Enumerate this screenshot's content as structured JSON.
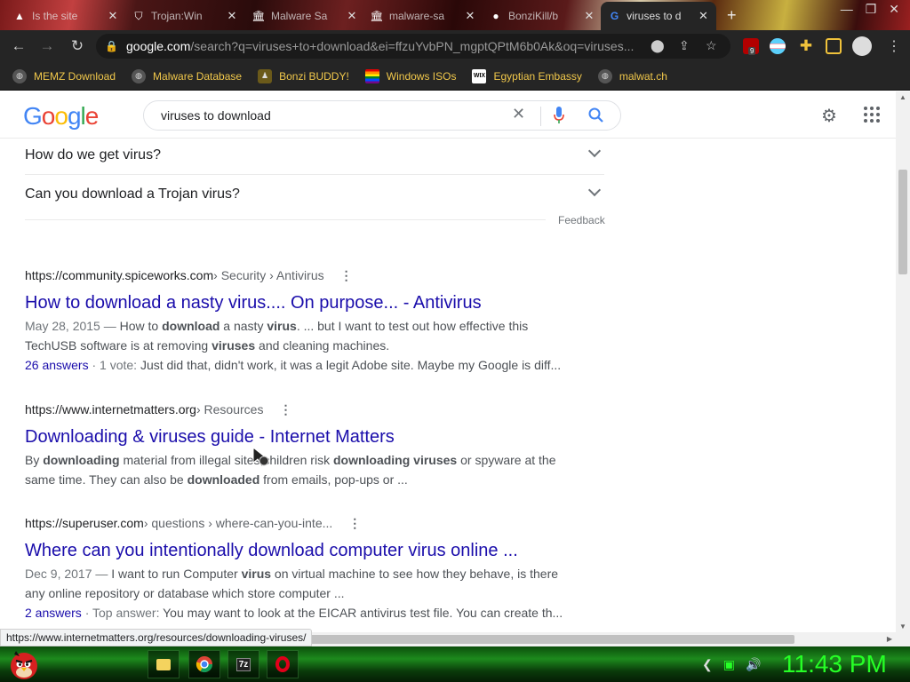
{
  "browser": {
    "tabs": [
      {
        "title": "Is the site",
        "icon": "warning-icon"
      },
      {
        "title": "Trojan:Win",
        "icon": "shield-icon"
      },
      {
        "title": "Malware Sa",
        "icon": "bank-icon"
      },
      {
        "title": "malware-sa",
        "icon": "bank-icon"
      },
      {
        "title": "BonziKill/b",
        "icon": "github-icon"
      },
      {
        "title": "viruses to d",
        "icon": "google-icon",
        "active": true
      }
    ],
    "url_domain": "google.com",
    "url_rest": "/search?q=viruses+to+download&ei=ffzuYvbPN_mgptQPtM6b0Ak&oq=viruses...",
    "extension_badge": "9",
    "bookmarks": [
      {
        "label": "MEMZ Download",
        "icon": "globe-icon"
      },
      {
        "label": "Malware Database",
        "icon": "globe-icon"
      },
      {
        "label": "Bonzi BUDDY!",
        "icon": "bonzi-icon"
      },
      {
        "label": "Windows ISOs",
        "icon": "windows-icon"
      },
      {
        "label": "Egyptian Embassy",
        "icon": "wix-icon"
      },
      {
        "label": "malwat.ch",
        "icon": "globe-icon"
      }
    ],
    "status_url": "https://www.internetmatters.org/resources/downloading-viruses/"
  },
  "google": {
    "logo": "Google",
    "query": "viruses to download"
  },
  "paa": [
    "How do we get virus?",
    "Can you download a Trojan virus?"
  ],
  "feedback_label": "Feedback",
  "results": [
    {
      "site": "https://community.spiceworks.com",
      "crumb": " › Security › Antivirus",
      "title": "How to download a nasty virus.... On purpose... - Antivirus",
      "date": "May 28, 2015 — ",
      "snippet_parts": [
        "How to ",
        "download",
        " a nasty ",
        "virus",
        ". ... but I want to test out how effective this TechUSB software is at removing ",
        "viruses",
        " and cleaning machines."
      ],
      "meta_link": "26 answers",
      "meta_gray": " · 1 vote: ",
      "meta_text": "Just did that, didn't work, it was a legit Adobe site. Maybe my Google is diff..."
    },
    {
      "site": "https://www.internetmatters.org",
      "crumb": " › Resources",
      "title": "Downloading & viruses guide - Internet Matters",
      "date": "",
      "snippet_parts": [
        "By ",
        "downloading",
        " material from illegal sites children risk ",
        "downloading viruses",
        " or spyware at the same time. They can also be ",
        "downloaded",
        " from emails, pop-ups or ..."
      ],
      "meta_link": "",
      "meta_gray": "",
      "meta_text": ""
    },
    {
      "site": "https://superuser.com",
      "crumb": " › questions › where-can-you-inte...",
      "title": "Where can you intentionally download computer virus online ...",
      "date": "Dec 9, 2017 — ",
      "snippet_parts": [
        "I want to run Computer ",
        "virus",
        " on virtual machine to see how they behave, is there any online repository or database which store computer ..."
      ],
      "meta_link": "2 answers",
      "meta_gray": " · Top answer: ",
      "meta_text": "You may want to look at the EICAR antivirus test file. You can create th..."
    }
  ],
  "taskbar": {
    "clock": "11:43 PM"
  },
  "colors": {
    "link": "#1a0dab",
    "bookmark_text": "#f1c84b",
    "clock": "#26ff26"
  }
}
